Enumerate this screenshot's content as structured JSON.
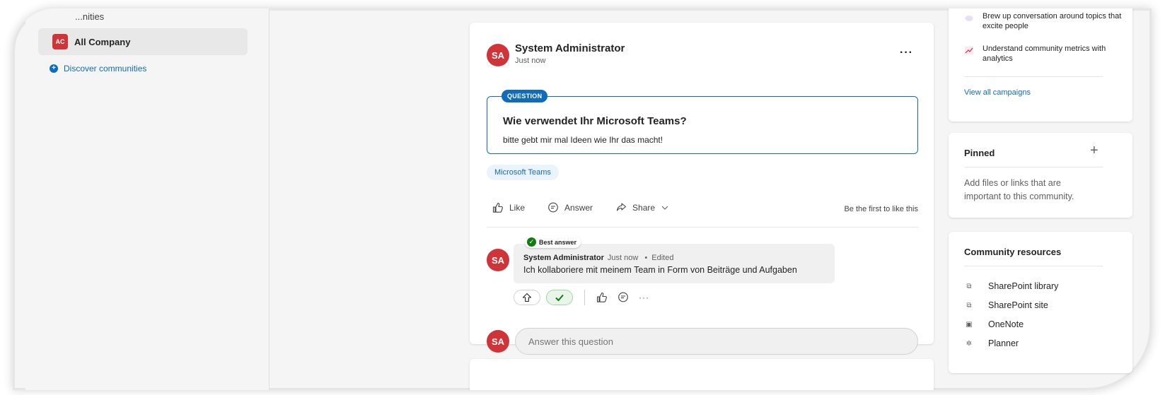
{
  "left_nav": {
    "partial_heading": "...nities",
    "community": {
      "initials": "AC",
      "name": "All Company"
    },
    "discover_label": "Discover communities"
  },
  "post": {
    "avatar_initials": "SA",
    "author": "System Administrator",
    "timestamp": "Just now",
    "more_label": "...",
    "question_badge": "QUESTION",
    "question_title": "Wie verwendet Ihr Microsoft Teams?",
    "question_body": "bitte gebt mir mal Ideen wie Ihr das macht!",
    "tag": "Microsoft Teams",
    "actions": {
      "like": "Like",
      "answer": "Answer",
      "share": "Share"
    },
    "like_status": "Be the first to like this",
    "reply": {
      "avatar_initials": "SA",
      "best_answer_label": "Best answer",
      "author": "System Administrator",
      "timestamp": "Just now",
      "separator": "•",
      "edited": "Edited",
      "text": "Ich kollaboriere mit meinem Team in Form von Beiträge und Aufgaben",
      "more_label": "···"
    },
    "answer_avatar_initials": "SA",
    "answer_placeholder": "Answer this question"
  },
  "campaigns": {
    "items": [
      {
        "icon": "bubble-icon",
        "text": "Brew up conversation around topics that excite people"
      },
      {
        "icon": "analytics-icon",
        "text": "Understand community metrics with analytics"
      }
    ],
    "view_all": "View all campaigns"
  },
  "pinned": {
    "title": "Pinned",
    "add_label": "+",
    "description": "Add files or links that are important to this community."
  },
  "resources": {
    "title": "Community resources",
    "items": [
      {
        "icon": "sharepoint-icon",
        "label": "SharePoint library"
      },
      {
        "icon": "sharepoint-icon",
        "label": "SharePoint site"
      },
      {
        "icon": "onenote-icon",
        "label": "OneNote"
      },
      {
        "icon": "planner-icon",
        "label": "Planner"
      }
    ]
  },
  "colors": {
    "brand_blue": "#0f6cbd",
    "avatar_red": "#d13438",
    "success_green": "#107c10"
  }
}
